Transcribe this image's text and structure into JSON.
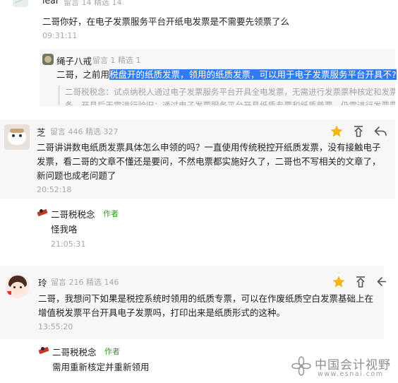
{
  "messages": [
    {
      "name": "lear",
      "meta": "留言 14 精选 14",
      "text": "二哥你好，在电子发票服务平台开纸电发票是不需要先领票了么",
      "time": "09:31:11"
    },
    {
      "name": "绳子八戒",
      "meta": "留言 1 精选 1",
      "text_before": "二哥，之前用",
      "text_highlight": "税盘开的纸质发票，领用的纸质发票，可以用于电子发票服务平台开具不?",
      "quote_line1": "二哥税税念：试点纳税人通过电子发票服务平台开具全电发票，无需进行发票票种核定和发票",
      "quote_line2": "条，开具后无需进行验旧；通过电子发票服务平台开具纸质专票和纸质普票，仍需进行发票票"
    },
    {
      "name": "芝",
      "meta": "留言 446 精选 327",
      "line1": "二哥讲讲数电纸质发票具体怎么申领的吗？一直使用传统税控开纸质发票，没有接触电子",
      "line2": "发票，看二哥的文章不懂还是要问，不然电票都实施好久了，二哥也不写相关的文章了，",
      "line3": "新问题也成老问题了",
      "time": "20:52:18",
      "reply": {
        "name": "二哥税税念",
        "tag": "作者",
        "text": "怪我咯",
        "time": "21:05:31"
      }
    },
    {
      "name": "玲",
      "meta": "留言 216 精选 146",
      "line1": "二哥，我想问下如果是税控系统时领用的纸质专票，可以在作废纸质空白发票基础上在",
      "line2": "增值税发票平台开具电子发票吗，打印出来是纸质形式的这种。",
      "time": "13:55:20",
      "reply": {
        "name": "二哥税税念",
        "tag": "作者",
        "text": "需用重新核定并重新领用"
      }
    }
  ],
  "watermark": {
    "cn": "中国会计视野",
    "url": "www.esnai.com"
  },
  "colors": {
    "highlight": "#2f7bf0",
    "star": "#f3b51a",
    "author_tag": "#3a9a2a",
    "panel": "#f7f7f7"
  }
}
